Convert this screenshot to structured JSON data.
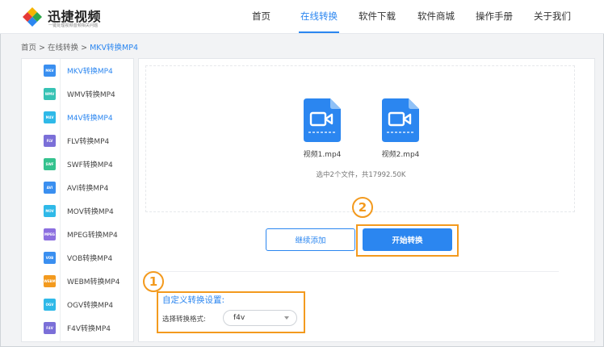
{
  "app": {
    "name": "迅捷视频",
    "tagline": "一键处理视频音频相关问题"
  },
  "nav": {
    "items": [
      {
        "label": "首页"
      },
      {
        "label": "在线转换"
      },
      {
        "label": "软件下载"
      },
      {
        "label": "软件商城"
      },
      {
        "label": "操作手册"
      },
      {
        "label": "关于我们"
      }
    ],
    "active_index": 1
  },
  "breadcrumb": {
    "home": "首页",
    "sep1": ">",
    "section": "在线转换",
    "sep2": ">",
    "current": "MKV转换MP4"
  },
  "sidebar": {
    "active_index": 0,
    "items": [
      {
        "badge": "MKV",
        "label": "MKV转换MP4",
        "color": "#3a8ff0"
      },
      {
        "badge": "WMV",
        "label": "WMV转换MP4",
        "color": "#36c2b4"
      },
      {
        "badge": "M4V",
        "label": "M4V转换MP4",
        "color": "#2fb9e8"
      },
      {
        "badge": "FLV",
        "label": "FLV转换MP4",
        "color": "#7b6fd8"
      },
      {
        "badge": "SWF",
        "label": "SWF转换MP4",
        "color": "#34c28e"
      },
      {
        "badge": "AVI",
        "label": "AVI转换MP4",
        "color": "#3a8ff0"
      },
      {
        "badge": "MOV",
        "label": "MOV转换MP4",
        "color": "#2fb9e8"
      },
      {
        "badge": "MPEG",
        "label": "MPEG转换MP4",
        "color": "#8c6fe0"
      },
      {
        "badge": "VOB",
        "label": "VOB转换MP4",
        "color": "#3a8ff0"
      },
      {
        "badge": "WEBM",
        "label": "WEBM转换MP4",
        "color": "#f39a1e"
      },
      {
        "badge": "OGV",
        "label": "OGV转换MP4",
        "color": "#2fb9e8"
      },
      {
        "badge": "F4V",
        "label": "F4V转换MP4",
        "color": "#7b6fd8"
      }
    ]
  },
  "files": {
    "items": [
      {
        "name": "视频1.mp4",
        "icon": "video-file-icon"
      },
      {
        "name": "视频2.mp4",
        "icon": "video-file-icon"
      }
    ],
    "summary": "选中2个文件，共17992.50K"
  },
  "actions": {
    "add_label": "继续添加",
    "start_label": "开始转换"
  },
  "callouts": {
    "one": "1",
    "two": "2"
  },
  "settings": {
    "title": "自定义转换设置:",
    "format_label": "选择转换格式:",
    "format_value": "f4v"
  },
  "colors": {
    "accent": "#2b86f0",
    "highlight": "#f39a1e"
  }
}
